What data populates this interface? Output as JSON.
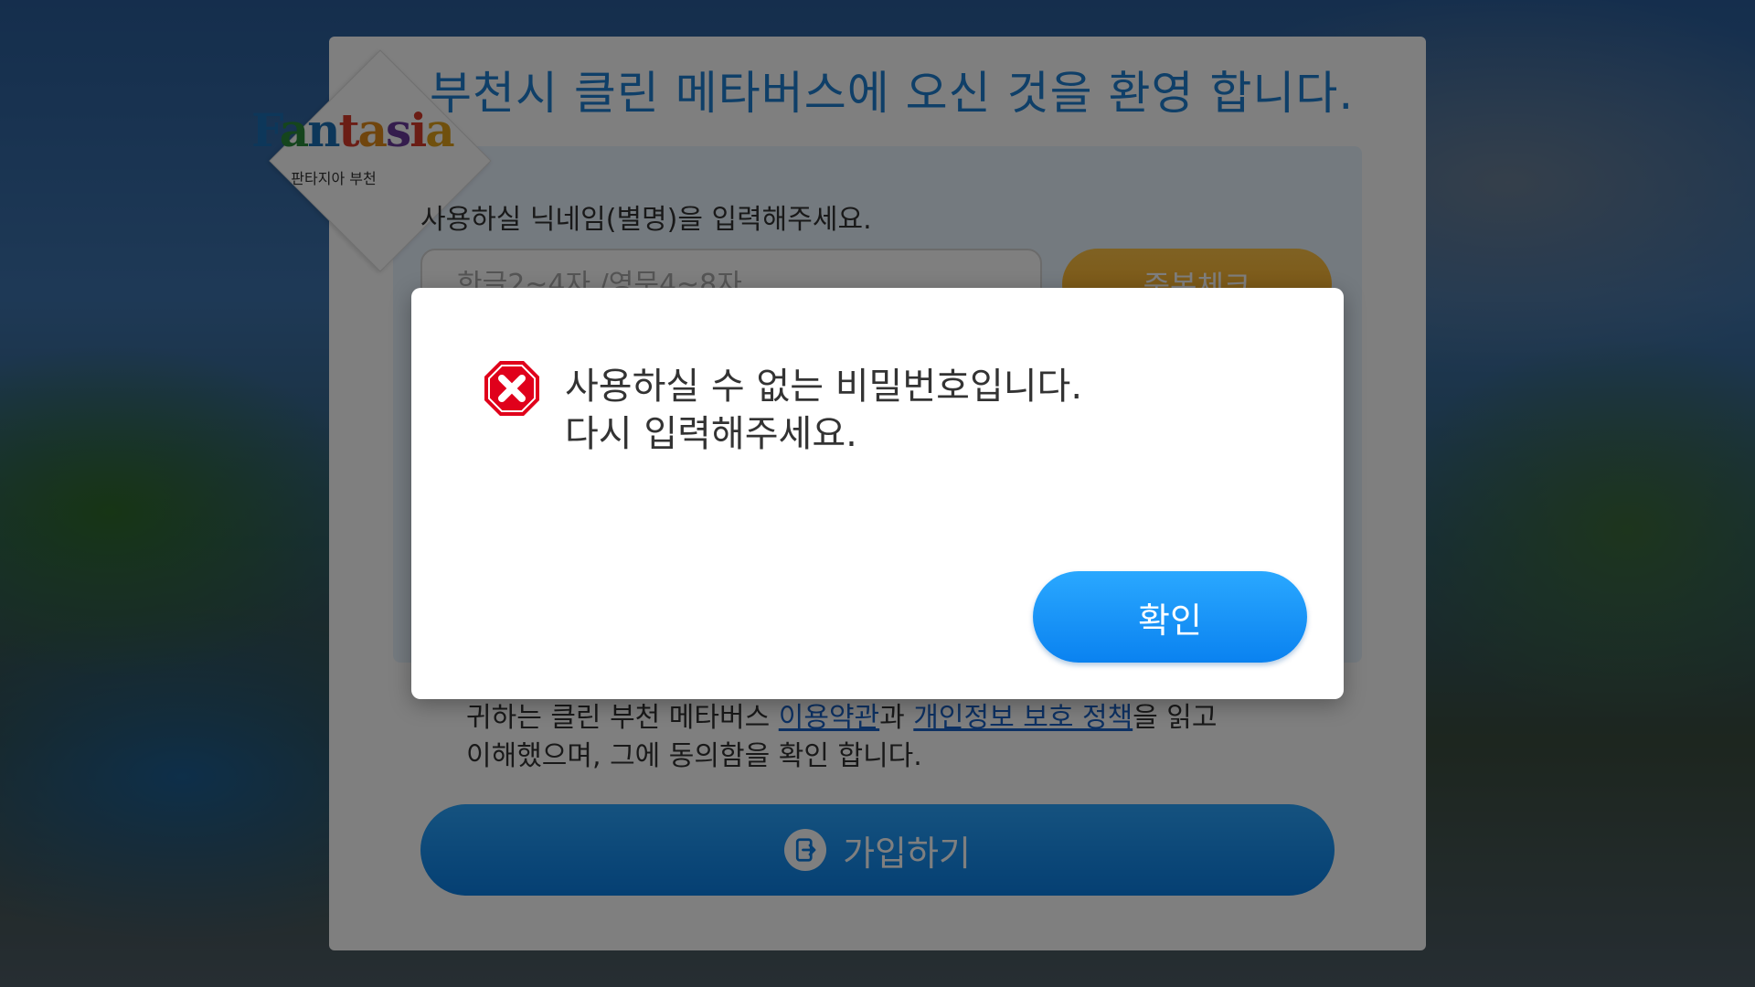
{
  "panel": {
    "title": "부천시 클린 메타버스에 오신 것을 환영 합니다.",
    "logo": {
      "text": "Fantasia",
      "subtitle": "판타지아 부천"
    },
    "nickname": {
      "label": "사용하실 닉네임(별명)을 입력해주세요.",
      "placeholder": "한글2~4자 /영문4~8자",
      "check_button": "중복체크"
    },
    "agreement": {
      "text_before": "귀하는 클린 부천 메타버스 ",
      "terms_link": "이용약관",
      "text_middle": "과 ",
      "privacy_link": "개인정보 보호 정책",
      "text_after": "을 읽고",
      "line2": "이해했으며, 그에 동의함을 확인 합니다."
    },
    "join_button": "가입하기"
  },
  "dialog": {
    "icon": "error-stop-icon",
    "message_line1": "사용하실 수 없는 비밀번호입니다.",
    "message_line2": "다시 입력해주세요.",
    "confirm_button": "확인"
  },
  "colors": {
    "accent_blue": "#0a82f0",
    "title_blue": "#1e7fd0",
    "orange": "#f7a81f",
    "error_red": "#e0001b"
  }
}
